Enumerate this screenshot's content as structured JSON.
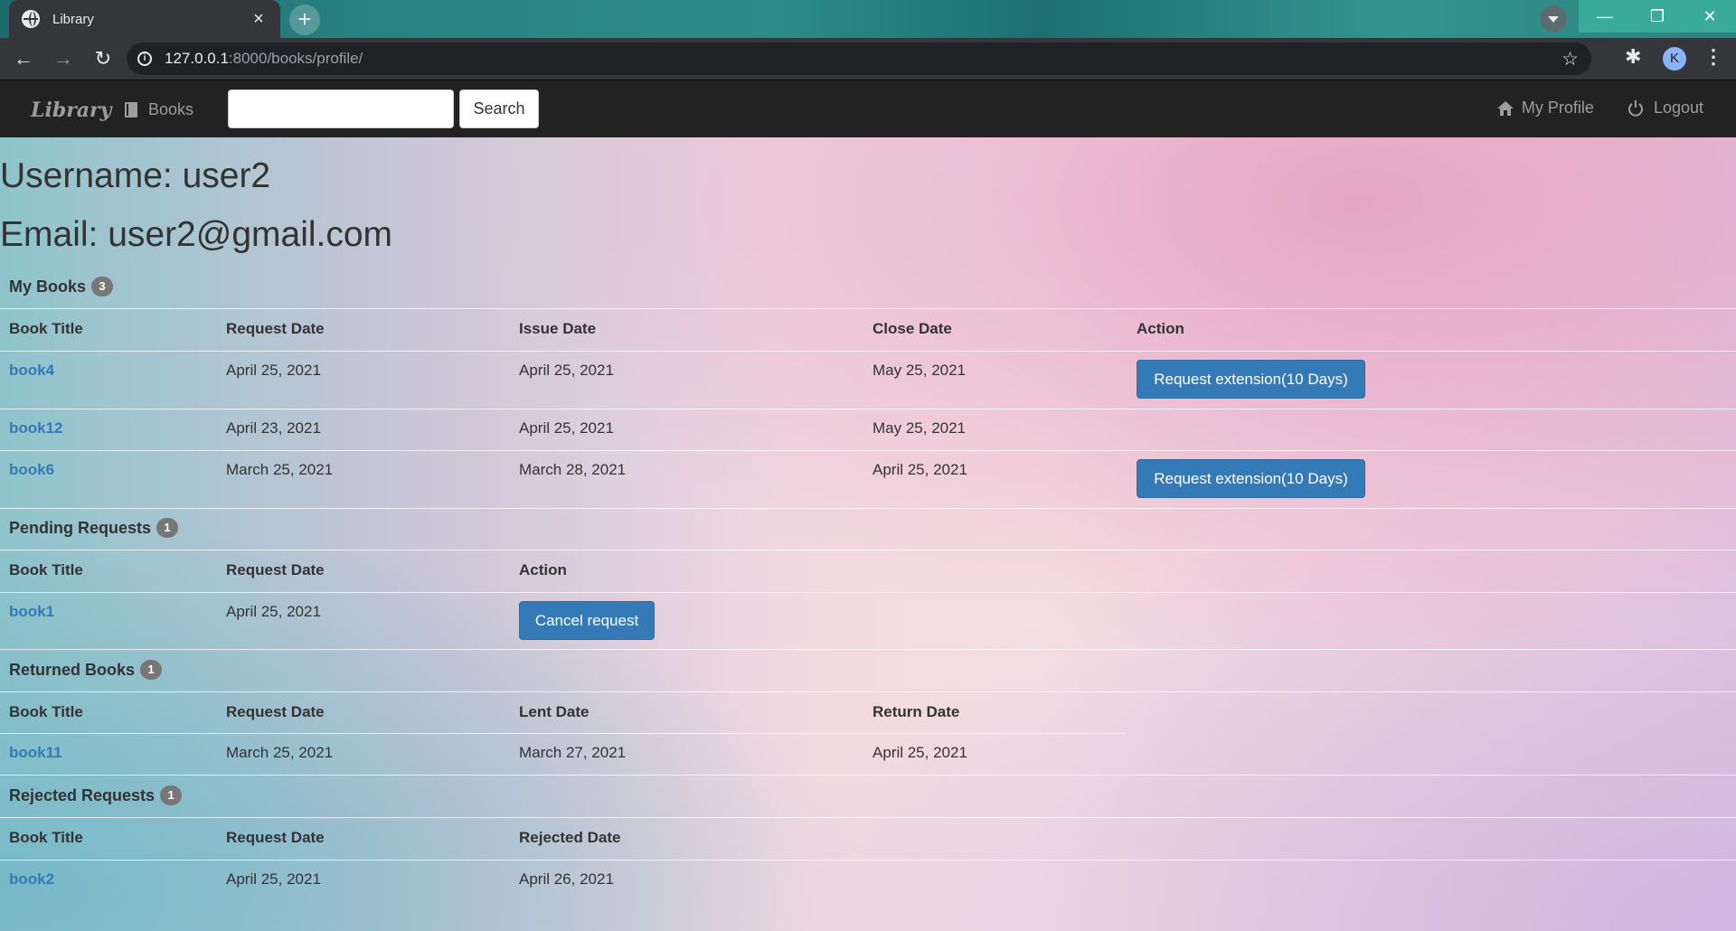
{
  "browser": {
    "tab_title": "Library",
    "new_tab": "+",
    "url_host": "127.0.0.1",
    "url_rest": ":8000/books/profile/",
    "profile_initial": "K",
    "icons": [
      "globe-icon",
      "close-icon",
      "back-icon",
      "forward-icon",
      "reload-icon",
      "info-icon",
      "star-icon",
      "puzzle-icon",
      "kebab-menu-icon",
      "minimize-icon",
      "restore-icon",
      "window-close-icon"
    ]
  },
  "navbar": {
    "brand": "Library",
    "books_label": "Books",
    "search_value": "",
    "search_button": "Search",
    "profile_label": "My Profile",
    "logout_label": "Logout"
  },
  "user": {
    "username_line": "Username: user2",
    "email_line": "Email: user2@gmail.com"
  },
  "my_books": {
    "title": "My Books",
    "count": "3",
    "headers": [
      "Book Title",
      "Request Date",
      "Issue Date",
      "Close Date",
      "Action"
    ],
    "rows": [
      {
        "title": "book4",
        "request": "April 25, 2021",
        "issue": "April 25, 2021",
        "close": "May 25, 2021",
        "action": "Request extension(10 Days)"
      },
      {
        "title": "book12",
        "request": "April 23, 2021",
        "issue": "April 25, 2021",
        "close": "May 25, 2021",
        "action": ""
      },
      {
        "title": "book6",
        "request": "March 25, 2021",
        "issue": "March 28, 2021",
        "close": "April 25, 2021",
        "action": "Request extension(10 Days)"
      }
    ]
  },
  "pending": {
    "title": "Pending Requests",
    "count": "1",
    "headers": [
      "Book Title",
      "Request Date",
      "Action"
    ],
    "rows": [
      {
        "title": "book1",
        "request": "April 25, 2021",
        "action": "Cancel request"
      }
    ]
  },
  "returned": {
    "title": "Returned Books",
    "count": "1",
    "headers": [
      "Book Title",
      "Request Date",
      "Lent Date",
      "Return Date"
    ],
    "rows": [
      {
        "title": "book11",
        "request": "March 25, 2021",
        "lent": "March 27, 2021",
        "returned": "April 25, 2021"
      }
    ]
  },
  "rejected": {
    "title": "Rejected Requests",
    "count": "1",
    "headers": [
      "Book Title",
      "Request Date",
      "Rejected Date"
    ],
    "rows": [
      {
        "title": "book2",
        "request": "April 25, 2021",
        "rejected": "April 26, 2021"
      }
    ]
  }
}
